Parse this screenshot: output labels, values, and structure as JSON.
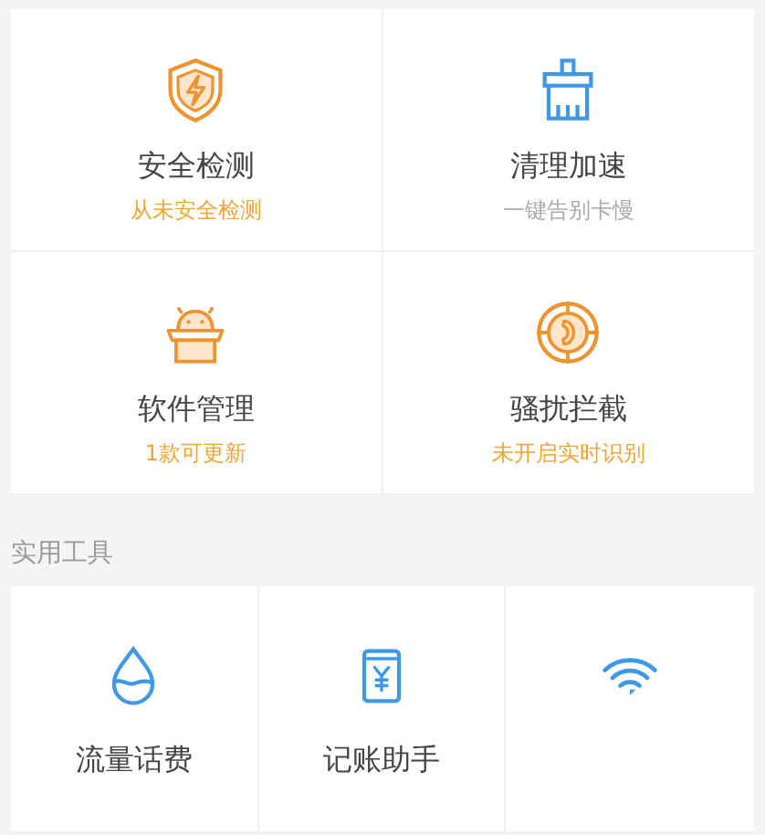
{
  "features": [
    {
      "title": "安全检测",
      "subtitle": "从未安全检测",
      "highlight": true
    },
    {
      "title": "清理加速",
      "subtitle": "一键告别卡慢",
      "highlight": false
    },
    {
      "title": "软件管理",
      "subtitle": "1款可更新",
      "highlight": true
    },
    {
      "title": "骚扰拦截",
      "subtitle": "未开启实时识别",
      "highlight": true
    }
  ],
  "tools_section": {
    "heading": "实用工具",
    "tools": [
      {
        "kind": "drop",
        "label": "流量话费"
      },
      {
        "kind": "ledger",
        "label": "记账助手"
      },
      {
        "kind": "wifi"
      }
    ]
  }
}
